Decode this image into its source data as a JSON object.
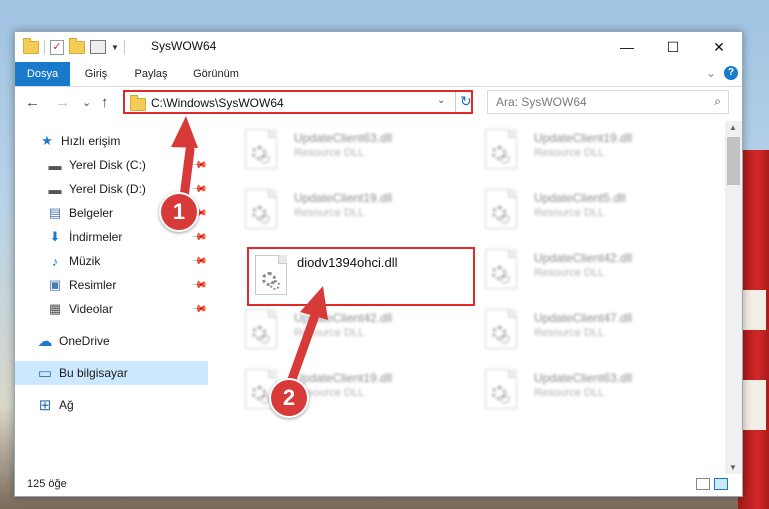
{
  "window": {
    "title": "SysWOW64",
    "minimize": "—",
    "maximize": "☐",
    "close": "✕"
  },
  "ribbon": {
    "tabs": [
      "Dosya",
      "Giriş",
      "Paylaş",
      "Görünüm"
    ],
    "collapse": "⌄",
    "help": "?"
  },
  "nav": {
    "back": "←",
    "forward": "→",
    "recent": "⌄",
    "up": "↑",
    "address": "C:\\Windows\\SysWOW64",
    "address_dropdown": "⌄",
    "refresh": "↻",
    "search_placeholder": "Ara: SysWOW64",
    "search_icon": "⌕"
  },
  "sidebar": {
    "items": [
      {
        "label": "Hızlı erişim",
        "icon": "star-icon",
        "glyph": "★",
        "pinned": false
      },
      {
        "label": "Yerel Disk (C:)",
        "icon": "drive-icon",
        "glyph": "▬",
        "pinned": true
      },
      {
        "label": "Yerel Disk (D:)",
        "icon": "drive-icon",
        "glyph": "▬",
        "pinned": true
      },
      {
        "label": "Belgeler",
        "icon": "documents-icon",
        "glyph": "▤",
        "pinned": true
      },
      {
        "label": "İndirmeler",
        "icon": "download-icon",
        "glyph": "⬇",
        "pinned": true
      },
      {
        "label": "Müzik",
        "icon": "music-icon",
        "glyph": "♪",
        "pinned": true
      },
      {
        "label": "Resimler",
        "icon": "pictures-icon",
        "glyph": "▣",
        "pinned": true
      },
      {
        "label": "Videolar",
        "icon": "video-icon",
        "glyph": "▦",
        "pinned": true
      },
      {
        "label": "OneDrive",
        "icon": "cloud-icon",
        "glyph": "☁",
        "pinned": false
      },
      {
        "label": "Bu bilgisayar",
        "icon": "computer-icon",
        "glyph": "▭",
        "pinned": false
      },
      {
        "label": "Ağ",
        "icon": "network-icon",
        "glyph": "⊞",
        "pinned": false
      }
    ],
    "pin_glyph": "📌"
  },
  "files": {
    "tiles": [
      {
        "name": "UpdateClient63.dll",
        "type": "Resource DLL"
      },
      {
        "name": "UpdateClient19.dll",
        "type": "Resource DLL"
      },
      {
        "name": "UpdateClient19.dll",
        "type": "Resource DLL"
      },
      {
        "name": "UpdateClient5.dll",
        "type": "Resource DLL"
      },
      {
        "name": "diodv1394ohci.dll",
        "type": ""
      },
      {
        "name": "UpdateClient42.dll",
        "type": "Resource DLL"
      },
      {
        "name": "UpdateClient42.dll",
        "type": "Resource DLL"
      },
      {
        "name": "UpdateClient47.dll",
        "type": "Resource DLL"
      },
      {
        "name": "UpdateClient19.dll",
        "type": "Resource DLL"
      },
      {
        "name": "UpdateClient63.dll",
        "type": "Resource DLL"
      }
    ]
  },
  "status": {
    "count": "125 öğe"
  },
  "annotations": {
    "step1": "1",
    "step2": "2",
    "color": "#d83a3a"
  }
}
